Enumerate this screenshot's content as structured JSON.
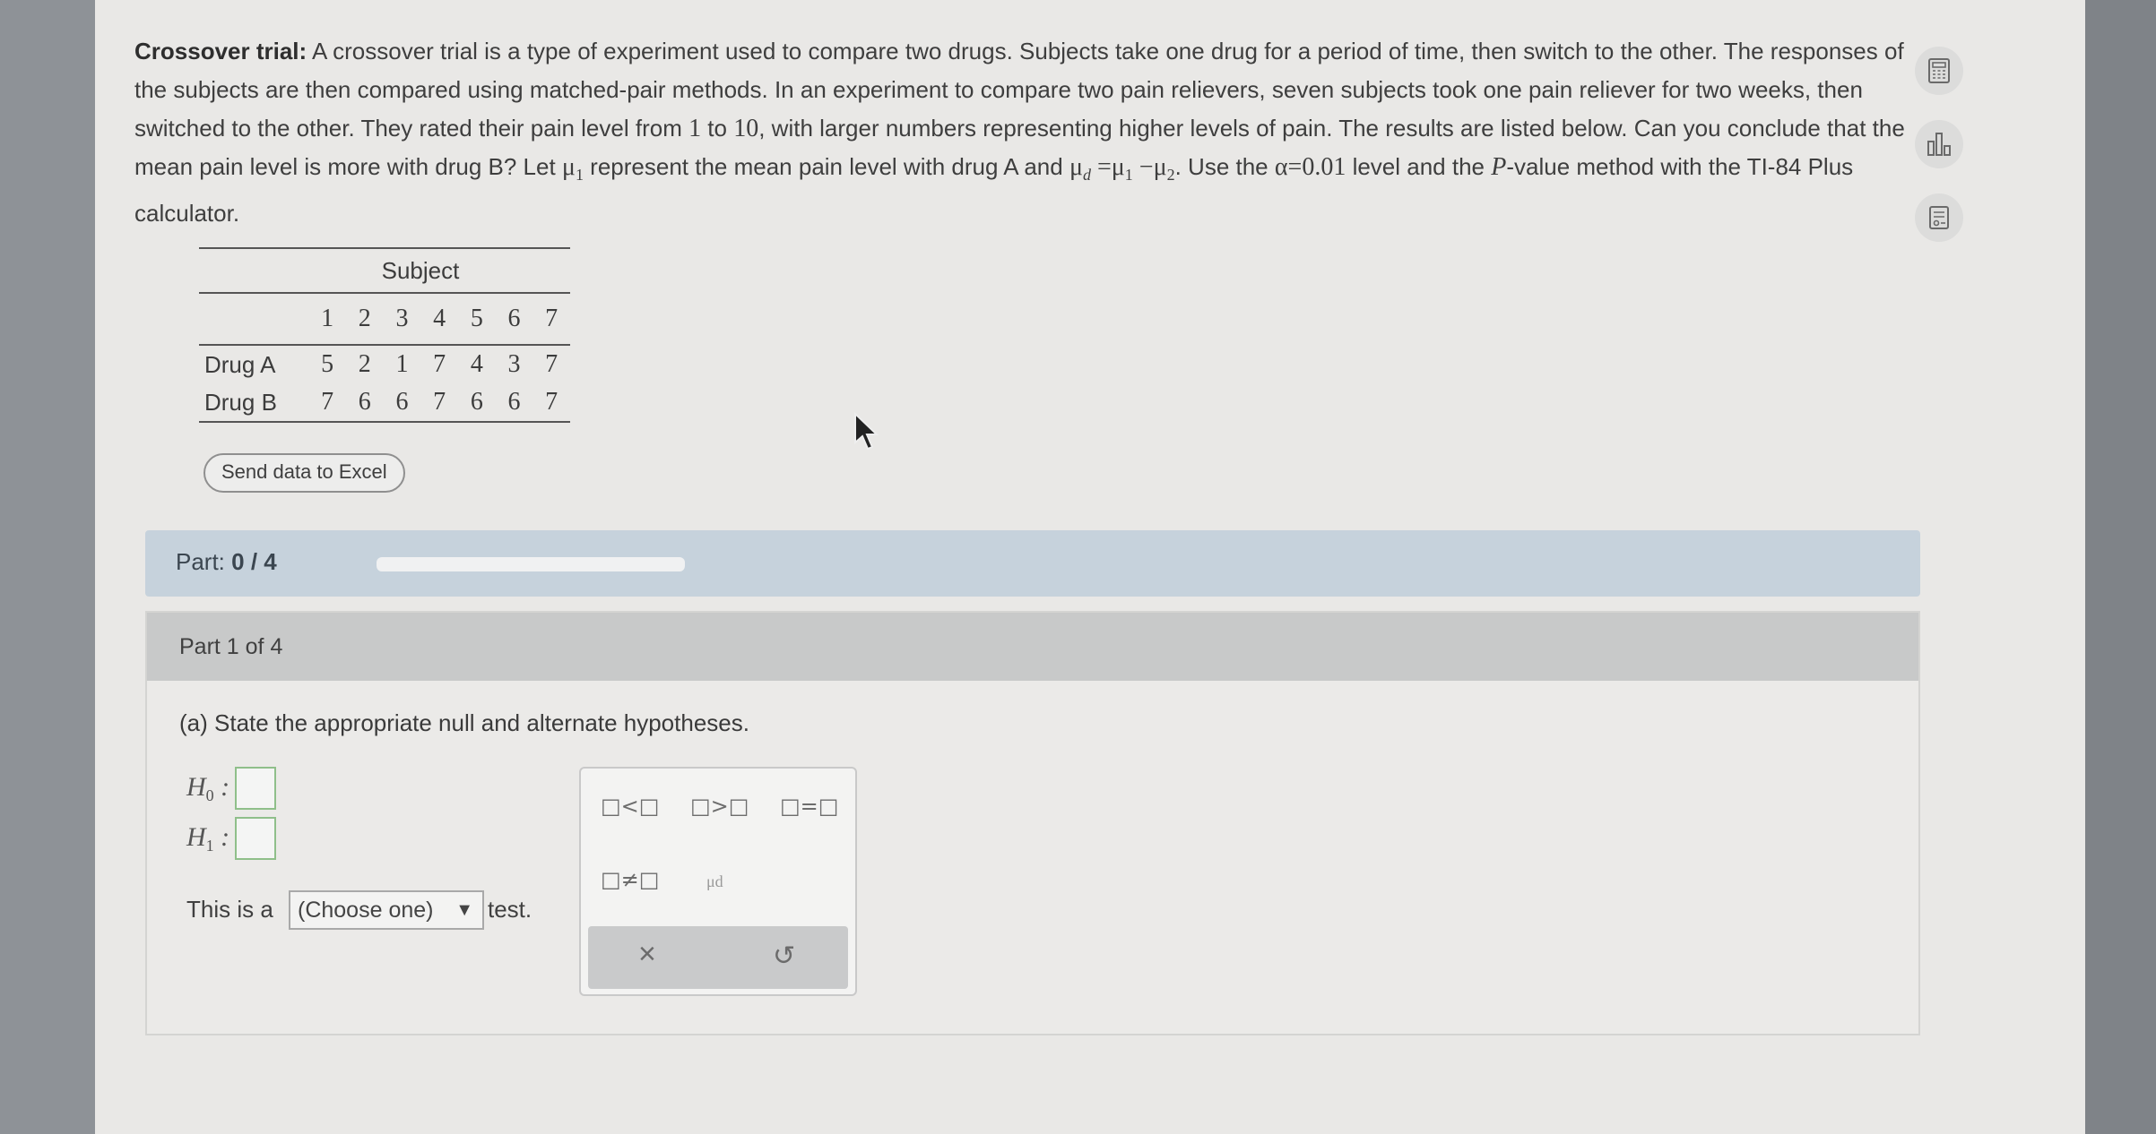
{
  "problem": {
    "title": "Crossover trial:",
    "text1": "A crossover trial is a type of experiment used to compare two drugs. Subjects take one drug for a period of time, then switch to the other. The responses of the subjects are then compared using matched-pair methods. In an experiment to compare two pain relievers, seven subjects took one pain reliever for two weeks, then switched to the other. They rated their pain level from ",
    "one": "1",
    "to_word": " to ",
    "ten": "10",
    "text2": ", with larger numbers representing higher levels of pain. The results are listed below. Can you conclude that the mean pain level is more with drug B? Let ",
    "text3": " represent the mean pain level with drug A and ",
    "text4": ". Use the ",
    "alpha": "α=0.01",
    "text5": " level and the ",
    "p_italic": "P",
    "text6": "-value method with the TI-84 Plus calculator."
  },
  "table": {
    "header": "Subject",
    "subjects": [
      "1",
      "2",
      "3",
      "4",
      "5",
      "6",
      "7"
    ],
    "rows": [
      {
        "label": "Drug A",
        "values": [
          "5",
          "2",
          "1",
          "7",
          "4",
          "3",
          "7"
        ]
      },
      {
        "label": "Drug B",
        "values": [
          "7",
          "6",
          "6",
          "7",
          "6",
          "6",
          "7"
        ]
      }
    ]
  },
  "send_button": "Send data to Excel",
  "part_bar": {
    "label": "Part:",
    "progress": "0 / 4",
    "progress_fraction": 0
  },
  "part_panel": {
    "header": "Part 1 of 4",
    "question": "(a) State the appropriate null and alternate hypotheses.",
    "h0": "H",
    "h0_sub": "0",
    "h1": "H",
    "h1_sub": "1",
    "test_prefix": "This is a",
    "select_value": "(Choose one)",
    "test_suffix": "test."
  },
  "palette": {
    "lt": "□<□",
    "gt": "□>□",
    "eq": "□=□",
    "ne": "□≠□",
    "mu_d": "μd",
    "clear": "×",
    "undo": "↺"
  },
  "icons": {
    "calculator": "calculator-icon",
    "chart": "bar-chart-icon",
    "table": "data-table-icon"
  }
}
